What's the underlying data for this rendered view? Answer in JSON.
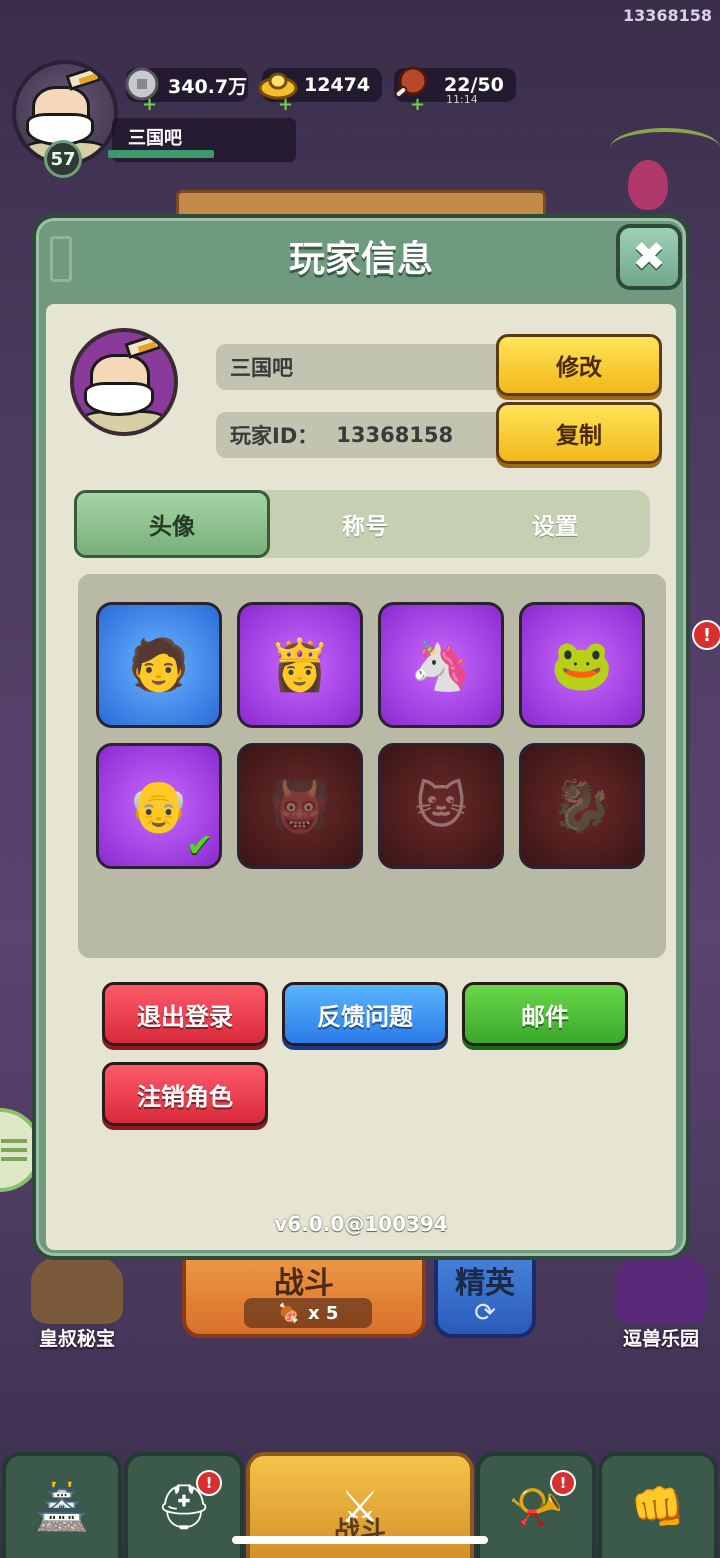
{
  "hud": {
    "corner_player_id": "13368158",
    "level": "57",
    "player_name": "三国吧",
    "coins": "340.7万",
    "gold": "12474",
    "stamina": "22/50",
    "stamina_timer": "11:14",
    "xp_fraction": 0.56
  },
  "modal": {
    "title": "玩家信息",
    "close_label": "✖",
    "name_value": "三国吧",
    "edit_label": "修改",
    "id_label": "玩家ID：",
    "id_value": "13368158",
    "copy_label": "复制",
    "tabs": [
      {
        "label": "头像",
        "active": true
      },
      {
        "label": "称号",
        "active": false
      },
      {
        "label": "设置",
        "active": false
      }
    ],
    "avatars": [
      {
        "icon": "green-headband-hero-avatar",
        "glyph": "🧑",
        "rarity": "blue",
        "locked": false,
        "selected": false
      },
      {
        "icon": "purple-hair-warrior-avatar",
        "glyph": "👸",
        "rarity": "purple",
        "locked": false,
        "selected": false
      },
      {
        "icon": "unicorn-avatar",
        "glyph": "🦄",
        "rarity": "purple",
        "locked": false,
        "selected": false
      },
      {
        "icon": "frog-avatar",
        "glyph": "🐸",
        "rarity": "purple",
        "locked": false,
        "selected": false
      },
      {
        "icon": "elder-sage-avatar",
        "glyph": "👴",
        "rarity": "purple",
        "locked": false,
        "selected": true
      },
      {
        "icon": "demon-warrior-avatar",
        "glyph": "👹",
        "rarity": "red",
        "locked": true,
        "selected": false
      },
      {
        "icon": "lucky-cat-avatar",
        "glyph": "🐱",
        "rarity": "red",
        "locked": true,
        "selected": false
      },
      {
        "icon": "dragon-avatar",
        "glyph": "🐉",
        "rarity": "red",
        "locked": true,
        "selected": false
      }
    ],
    "logout_label": "退出登录",
    "feedback_label": "反馈问题",
    "mail_label": "邮件",
    "delete_role_label": "注销角色",
    "version": "v6.0.0@100394"
  },
  "scene": {
    "battle_label": "战斗",
    "battle_cost": "x 5",
    "elite_label": "精英",
    "left_building_label": "皇叔秘宝",
    "right_building_label": "逗兽乐园",
    "nav_battle_label": "战斗"
  },
  "colors": {
    "modal_frame": "#6f9a7e",
    "modal_body": "#e6e4d2",
    "accent_yellow": "#f2b81a",
    "button_red": "#d82a3a",
    "button_blue": "#2a7ae8",
    "button_green": "#3aa82a"
  }
}
